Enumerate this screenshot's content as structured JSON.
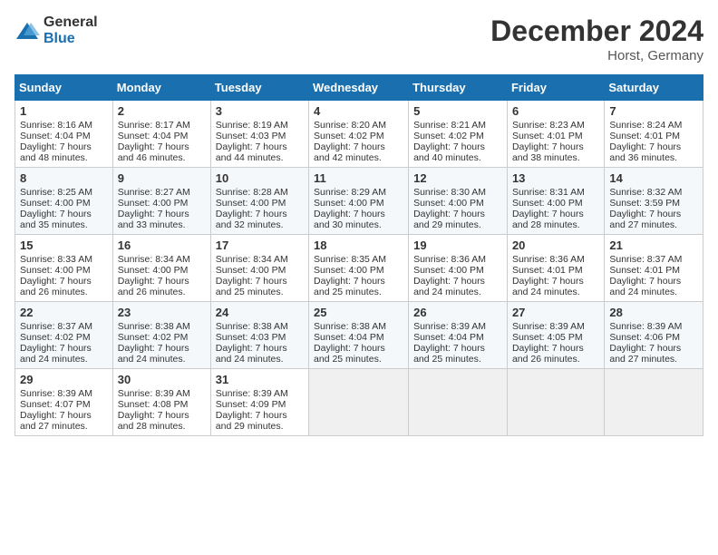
{
  "header": {
    "logo_general": "General",
    "logo_blue": "Blue",
    "month": "December 2024",
    "location": "Horst, Germany"
  },
  "days_of_week": [
    "Sunday",
    "Monday",
    "Tuesday",
    "Wednesday",
    "Thursday",
    "Friday",
    "Saturday"
  ],
  "weeks": [
    [
      {
        "day": "1",
        "sunrise": "8:16 AM",
        "sunset": "4:04 PM",
        "daylight": "7 hours and 48 minutes."
      },
      {
        "day": "2",
        "sunrise": "8:17 AM",
        "sunset": "4:04 PM",
        "daylight": "7 hours and 46 minutes."
      },
      {
        "day": "3",
        "sunrise": "8:19 AM",
        "sunset": "4:03 PM",
        "daylight": "7 hours and 44 minutes."
      },
      {
        "day": "4",
        "sunrise": "8:20 AM",
        "sunset": "4:02 PM",
        "daylight": "7 hours and 42 minutes."
      },
      {
        "day": "5",
        "sunrise": "8:21 AM",
        "sunset": "4:02 PM",
        "daylight": "7 hours and 40 minutes."
      },
      {
        "day": "6",
        "sunrise": "8:23 AM",
        "sunset": "4:01 PM",
        "daylight": "7 hours and 38 minutes."
      },
      {
        "day": "7",
        "sunrise": "8:24 AM",
        "sunset": "4:01 PM",
        "daylight": "7 hours and 36 minutes."
      }
    ],
    [
      {
        "day": "8",
        "sunrise": "8:25 AM",
        "sunset": "4:00 PM",
        "daylight": "7 hours and 35 minutes."
      },
      {
        "day": "9",
        "sunrise": "8:27 AM",
        "sunset": "4:00 PM",
        "daylight": "7 hours and 33 minutes."
      },
      {
        "day": "10",
        "sunrise": "8:28 AM",
        "sunset": "4:00 PM",
        "daylight": "7 hours and 32 minutes."
      },
      {
        "day": "11",
        "sunrise": "8:29 AM",
        "sunset": "4:00 PM",
        "daylight": "7 hours and 30 minutes."
      },
      {
        "day": "12",
        "sunrise": "8:30 AM",
        "sunset": "4:00 PM",
        "daylight": "7 hours and 29 minutes."
      },
      {
        "day": "13",
        "sunrise": "8:31 AM",
        "sunset": "4:00 PM",
        "daylight": "7 hours and 28 minutes."
      },
      {
        "day": "14",
        "sunrise": "8:32 AM",
        "sunset": "3:59 PM",
        "daylight": "7 hours and 27 minutes."
      }
    ],
    [
      {
        "day": "15",
        "sunrise": "8:33 AM",
        "sunset": "4:00 PM",
        "daylight": "7 hours and 26 minutes."
      },
      {
        "day": "16",
        "sunrise": "8:34 AM",
        "sunset": "4:00 PM",
        "daylight": "7 hours and 26 minutes."
      },
      {
        "day": "17",
        "sunrise": "8:34 AM",
        "sunset": "4:00 PM",
        "daylight": "7 hours and 25 minutes."
      },
      {
        "day": "18",
        "sunrise": "8:35 AM",
        "sunset": "4:00 PM",
        "daylight": "7 hours and 25 minutes."
      },
      {
        "day": "19",
        "sunrise": "8:36 AM",
        "sunset": "4:00 PM",
        "daylight": "7 hours and 24 minutes."
      },
      {
        "day": "20",
        "sunrise": "8:36 AM",
        "sunset": "4:01 PM",
        "daylight": "7 hours and 24 minutes."
      },
      {
        "day": "21",
        "sunrise": "8:37 AM",
        "sunset": "4:01 PM",
        "daylight": "7 hours and 24 minutes."
      }
    ],
    [
      {
        "day": "22",
        "sunrise": "8:37 AM",
        "sunset": "4:02 PM",
        "daylight": "7 hours and 24 minutes."
      },
      {
        "day": "23",
        "sunrise": "8:38 AM",
        "sunset": "4:02 PM",
        "daylight": "7 hours and 24 minutes."
      },
      {
        "day": "24",
        "sunrise": "8:38 AM",
        "sunset": "4:03 PM",
        "daylight": "7 hours and 24 minutes."
      },
      {
        "day": "25",
        "sunrise": "8:38 AM",
        "sunset": "4:04 PM",
        "daylight": "7 hours and 25 minutes."
      },
      {
        "day": "26",
        "sunrise": "8:39 AM",
        "sunset": "4:04 PM",
        "daylight": "7 hours and 25 minutes."
      },
      {
        "day": "27",
        "sunrise": "8:39 AM",
        "sunset": "4:05 PM",
        "daylight": "7 hours and 26 minutes."
      },
      {
        "day": "28",
        "sunrise": "8:39 AM",
        "sunset": "4:06 PM",
        "daylight": "7 hours and 27 minutes."
      }
    ],
    [
      {
        "day": "29",
        "sunrise": "8:39 AM",
        "sunset": "4:07 PM",
        "daylight": "7 hours and 27 minutes."
      },
      {
        "day": "30",
        "sunrise": "8:39 AM",
        "sunset": "4:08 PM",
        "daylight": "7 hours and 28 minutes."
      },
      {
        "day": "31",
        "sunrise": "8:39 AM",
        "sunset": "4:09 PM",
        "daylight": "7 hours and 29 minutes."
      },
      null,
      null,
      null,
      null
    ]
  ]
}
